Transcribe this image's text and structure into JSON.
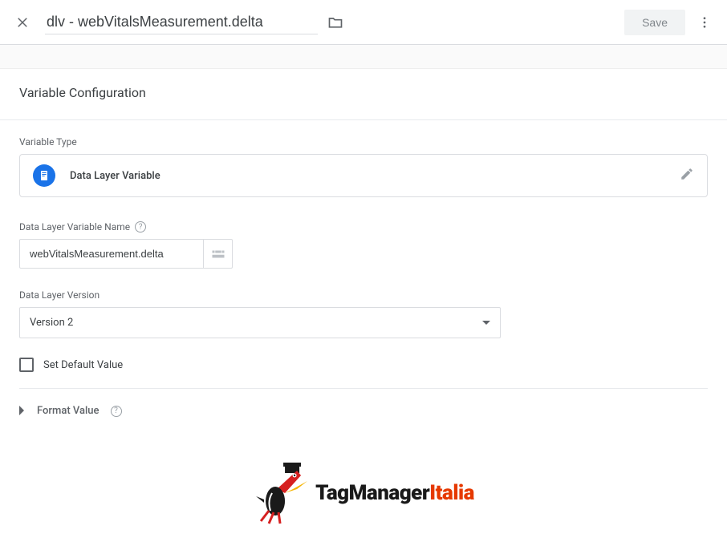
{
  "header": {
    "title": "dlv - webVitalsMeasurement.delta",
    "save_label": "Save"
  },
  "panel": {
    "title": "Variable Configuration",
    "type_section_label": "Variable Type",
    "type_name": "Data Layer Variable",
    "name_section_label": "Data Layer Variable Name",
    "name_value": "webVitalsMeasurement.delta",
    "version_section_label": "Data Layer Version",
    "version_value": "Version 2",
    "default_checkbox_label": "Set Default Value",
    "format_value_label": "Format Value"
  },
  "watermark": {
    "brand_main": "TagManager",
    "brand_accent": "Italia"
  }
}
